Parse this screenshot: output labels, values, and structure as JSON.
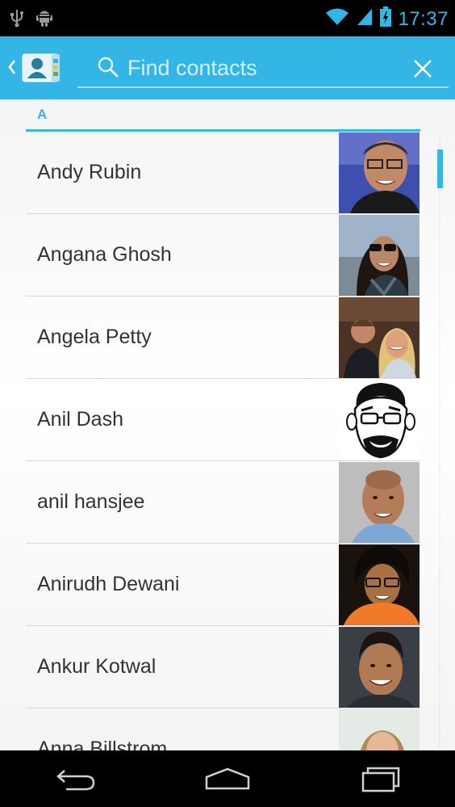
{
  "status_bar": {
    "time": "17:37",
    "icons": [
      "usb-icon",
      "android-debug-icon",
      "wifi-icon",
      "signal-icon",
      "battery-icon"
    ]
  },
  "action_bar": {
    "app_icon": "contacts-app-icon",
    "search": {
      "placeholder": "Find contacts",
      "value": ""
    },
    "close_icon": "close-icon"
  },
  "section": {
    "letter": "A"
  },
  "contacts": [
    {
      "name": "Andy Rubin"
    },
    {
      "name": "Angana Ghosh"
    },
    {
      "name": "Angela Petty"
    },
    {
      "name": "Anil Dash"
    },
    {
      "name": "anil hansjee"
    },
    {
      "name": "Anirudh Dewani"
    },
    {
      "name": "Ankur Kotwal"
    },
    {
      "name": "Anna Billstrom"
    }
  ],
  "nav_bar": {
    "buttons": [
      "back-icon",
      "home-icon",
      "recent-apps-icon"
    ]
  },
  "colors": {
    "accent": "#33b5e5",
    "status_bar": "#000000",
    "text": "#333333"
  }
}
